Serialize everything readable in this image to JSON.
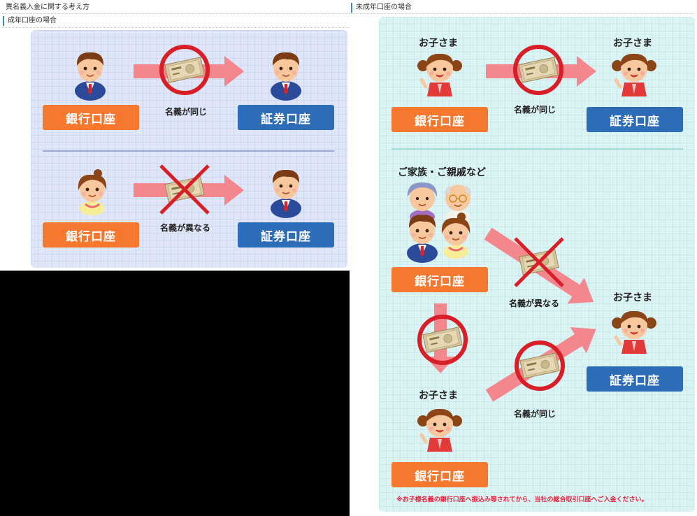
{
  "left_header": {
    "title": "異名義入金に関する考え方"
  },
  "right_header": {
    "title": "未成年口座の場合"
  },
  "left_sub": {
    "title": "成年口座の場合"
  },
  "adult": {
    "row1": {
      "bank_label": "銀行口座",
      "sec_label": "証券口座",
      "caption": "名義が同じ"
    },
    "row2": {
      "bank_label": "銀行口座",
      "sec_label": "証券口座",
      "caption": "名義が異なる"
    }
  },
  "minor": {
    "top": {
      "child_left": "お子さま",
      "child_right": "お子さま",
      "bank_label": "銀行口座",
      "sec_label": "証券口座",
      "caption": "名義が同じ"
    },
    "bottom": {
      "family_label": "ご家族・ご親戚など",
      "family_bank": "銀行口座",
      "caption_diff": "名義が異なる",
      "child_right": "お子さま",
      "sec_label": "証券口座",
      "child_bottom": "お子さま",
      "caption_same": "名義が同じ",
      "child_bank": "銀行口座",
      "note": "※お子様名義の銀行口座へ振込み等されてから、当社の総合取引口座へご入金ください。"
    }
  },
  "colors": {
    "accent_orange": "#f6782e",
    "accent_navy": "#2d6db8",
    "arrow_pink": "#f3878d",
    "ring_red": "#d81e26",
    "panel_blue": "#dfe6f7",
    "panel_mint": "#dcf3f4"
  }
}
